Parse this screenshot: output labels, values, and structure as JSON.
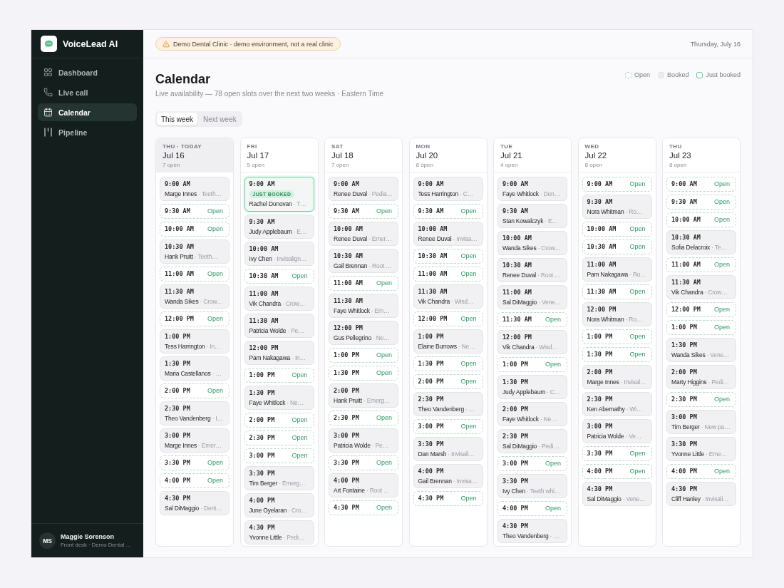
{
  "sidebar": {
    "app_name": "VoiceLead AI",
    "nav": [
      {
        "label": "Dashboard",
        "selected": false
      },
      {
        "label": "Live call",
        "selected": false
      },
      {
        "label": "Calendar",
        "selected": true
      },
      {
        "label": "Pipeline",
        "selected": false
      }
    ],
    "user": {
      "initials": "MS",
      "name": "Maggie Sorenson",
      "role": "Front desk · Demo Dental …"
    }
  },
  "top_bar": {
    "banner": "Demo Dental Clinic · demo environment, not a real clinic",
    "date": "Thursday, July 16"
  },
  "header": {
    "title": "Calendar",
    "subtitle": "Live availability — 78 open slots over the next two weeks · Eastern Time"
  },
  "legend": [
    {
      "kind": "open",
      "label": "Open"
    },
    {
      "kind": "booked",
      "label": "Booked"
    },
    {
      "kind": "just_booked",
      "label": "Just booked"
    }
  ],
  "tabs": [
    {
      "label": "This week",
      "selected": true
    },
    {
      "label": "Next week",
      "selected": false
    }
  ],
  "days": [
    {
      "day": "THU · TODAY",
      "date": "Jul 16",
      "open_count": "7 open",
      "today": true,
      "slots": [
        {
          "kind": "booked",
          "time": "9:00 AM",
          "patient": "Marge Innes",
          "detail": "· Teeth…"
        },
        {
          "kind": "open",
          "time": "9:30 AM",
          "label": "Open"
        },
        {
          "kind": "open",
          "time": "10:00 AM",
          "label": "Open"
        },
        {
          "kind": "booked",
          "time": "10:30 AM",
          "patient": "Hank Pruitt",
          "detail": "· Teeth…"
        },
        {
          "kind": "open",
          "time": "11:00 AM",
          "label": "Open"
        },
        {
          "kind": "booked",
          "time": "11:30 AM",
          "patient": "Wanda Sikes",
          "detail": "· Crow…"
        },
        {
          "kind": "open",
          "time": "12:00 PM",
          "label": "Open"
        },
        {
          "kind": "booked",
          "time": "1:00 PM",
          "patient": "Tess Harrington",
          "detail": "· In…"
        },
        {
          "kind": "booked",
          "time": "1:30 PM",
          "patient": "Maria Castellanos",
          "detail": "· …"
        },
        {
          "kind": "open",
          "time": "2:00 PM",
          "label": "Open"
        },
        {
          "kind": "booked",
          "time": "2:30 PM",
          "patient": "Theo Vandenberg",
          "detail": "· I…"
        },
        {
          "kind": "booked",
          "time": "3:00 PM",
          "patient": "Marge Innes",
          "detail": "· Emer…"
        },
        {
          "kind": "open",
          "time": "3:30 PM",
          "label": "Open"
        },
        {
          "kind": "open",
          "time": "4:00 PM",
          "label": "Open"
        },
        {
          "kind": "booked",
          "time": "4:30 PM",
          "patient": "Sal DiMaggio",
          "detail": "· Dent…"
        }
      ]
    },
    {
      "day": "FRI",
      "date": "Jul 17",
      "open_count": "5 open",
      "today": false,
      "slots": [
        {
          "kind": "just_booked",
          "time": "9:00 AM",
          "badge": "JUST BOOKED",
          "patient": "Rachel Donovan",
          "detail": "· T…"
        },
        {
          "kind": "booked",
          "time": "9:30 AM",
          "patient": "Judy Applebaum",
          "detail": "· E…"
        },
        {
          "kind": "booked",
          "time": "10:00 AM",
          "patient": "Ivy Chen",
          "detail": "· Invisalign…"
        },
        {
          "kind": "open",
          "time": "10:30 AM",
          "label": "Open"
        },
        {
          "kind": "booked",
          "time": "11:00 AM",
          "patient": "Vik Chandra",
          "detail": "· Crow…"
        },
        {
          "kind": "booked",
          "time": "11:30 AM",
          "patient": "Patricia Wolde",
          "detail": "· Pe…"
        },
        {
          "kind": "booked",
          "time": "12:00 PM",
          "patient": "Pam Nakagawa",
          "detail": "· In…"
        },
        {
          "kind": "open",
          "time": "1:00 PM",
          "label": "Open"
        },
        {
          "kind": "booked",
          "time": "1:30 PM",
          "patient": "Faye Whitlock",
          "detail": "· Ne…"
        },
        {
          "kind": "open",
          "time": "2:00 PM",
          "label": "Open"
        },
        {
          "kind": "open",
          "time": "2:30 PM",
          "label": "Open"
        },
        {
          "kind": "open",
          "time": "3:00 PM",
          "label": "Open"
        },
        {
          "kind": "booked",
          "time": "3:30 PM",
          "patient": "Tim Berger",
          "detail": "· Emerg…"
        },
        {
          "kind": "booked",
          "time": "4:00 PM",
          "patient": "June Oyelaran",
          "detail": "· Cro…"
        },
        {
          "kind": "booked",
          "time": "4:30 PM",
          "patient": "Yvonne Little",
          "detail": "· Pedi…"
        }
      ]
    },
    {
      "day": "SAT",
      "date": "Jul 18",
      "open_count": "7 open",
      "today": false,
      "slots": [
        {
          "kind": "booked",
          "time": "9:00 AM",
          "patient": "Renee Duval",
          "detail": "· Pedia…"
        },
        {
          "kind": "open",
          "time": "9:30 AM",
          "label": "Open"
        },
        {
          "kind": "booked",
          "time": "10:00 AM",
          "patient": "Renee Duval",
          "detail": "· Emer…"
        },
        {
          "kind": "booked",
          "time": "10:30 AM",
          "patient": "Gail Brennan",
          "detail": "· Root …"
        },
        {
          "kind": "open",
          "time": "11:00 AM",
          "label": "Open"
        },
        {
          "kind": "booked",
          "time": "11:30 AM",
          "patient": "Faye Whitlock",
          "detail": "· Em…"
        },
        {
          "kind": "booked",
          "time": "12:00 PM",
          "patient": "Gus Pellegrino",
          "detail": "· Ne…"
        },
        {
          "kind": "open",
          "time": "1:00 PM",
          "label": "Open"
        },
        {
          "kind": "open",
          "time": "1:30 PM",
          "label": "Open"
        },
        {
          "kind": "booked",
          "time": "2:00 PM",
          "patient": "Hank Pruitt",
          "detail": "· Emerg…"
        },
        {
          "kind": "open",
          "time": "2:30 PM",
          "label": "Open"
        },
        {
          "kind": "booked",
          "time": "3:00 PM",
          "patient": "Patricia Wolde",
          "detail": "· Pe…"
        },
        {
          "kind": "open",
          "time": "3:30 PM",
          "label": "Open"
        },
        {
          "kind": "booked",
          "time": "4:00 PM",
          "patient": "Art Fontaine",
          "detail": "· Root …"
        },
        {
          "kind": "open",
          "time": "4:30 PM",
          "label": "Open"
        }
      ]
    },
    {
      "day": "MON",
      "date": "Jul 20",
      "open_count": "8 open",
      "today": false,
      "slots": [
        {
          "kind": "booked",
          "time": "9:00 AM",
          "patient": "Tess Harrington",
          "detail": "· C…"
        },
        {
          "kind": "open",
          "time": "9:30 AM",
          "label": "Open"
        },
        {
          "kind": "booked",
          "time": "10:00 AM",
          "patient": "Renee Duval",
          "detail": "· Invisa…"
        },
        {
          "kind": "open",
          "time": "10:30 AM",
          "label": "Open"
        },
        {
          "kind": "open",
          "time": "11:00 AM",
          "label": "Open"
        },
        {
          "kind": "booked",
          "time": "11:30 AM",
          "patient": "Vik Chandra",
          "detail": "· Wisd…"
        },
        {
          "kind": "open",
          "time": "12:00 PM",
          "label": "Open"
        },
        {
          "kind": "booked",
          "time": "1:00 PM",
          "patient": "Elaine Burrows",
          "detail": "· Ne…"
        },
        {
          "kind": "open",
          "time": "1:30 PM",
          "label": "Open"
        },
        {
          "kind": "open",
          "time": "2:00 PM",
          "label": "Open"
        },
        {
          "kind": "booked",
          "time": "2:30 PM",
          "patient": "Theo Vandenberg",
          "detail": "· …"
        },
        {
          "kind": "open",
          "time": "3:00 PM",
          "label": "Open"
        },
        {
          "kind": "booked",
          "time": "3:30 PM",
          "patient": "Dan Marsh",
          "detail": "· Invisali…"
        },
        {
          "kind": "booked",
          "time": "4:00 PM",
          "patient": "Gail Brennan",
          "detail": "· Invisa…"
        },
        {
          "kind": "open",
          "time": "4:30 PM",
          "label": "Open"
        }
      ]
    },
    {
      "day": "TUE",
      "date": "Jul 21",
      "open_count": "4 open",
      "today": false,
      "slots": [
        {
          "kind": "booked",
          "time": "9:00 AM",
          "patient": "Faye Whitlock",
          "detail": "· Den…"
        },
        {
          "kind": "booked",
          "time": "9:30 AM",
          "patient": "Stan Kowalczyk",
          "detail": "· E…"
        },
        {
          "kind": "booked",
          "time": "10:00 AM",
          "patient": "Wanda Sikes",
          "detail": "· Crow…"
        },
        {
          "kind": "booked",
          "time": "10:30 AM",
          "patient": "Renee Duval",
          "detail": "· Root …"
        },
        {
          "kind": "booked",
          "time": "11:00 AM",
          "patient": "Sal DiMaggio",
          "detail": "· Vene…"
        },
        {
          "kind": "open",
          "time": "11:30 AM",
          "label": "Open"
        },
        {
          "kind": "booked",
          "time": "12:00 PM",
          "patient": "Vik Chandra",
          "detail": "· Wisd…"
        },
        {
          "kind": "open",
          "time": "1:00 PM",
          "label": "Open"
        },
        {
          "kind": "booked",
          "time": "1:30 PM",
          "patient": "Judy Applebaum",
          "detail": "· C…"
        },
        {
          "kind": "booked",
          "time": "2:00 PM",
          "patient": "Faye Whitlock",
          "detail": "· Ne…"
        },
        {
          "kind": "booked",
          "time": "2:30 PM",
          "patient": "Sal DiMaggio",
          "detail": "· Pedi…"
        },
        {
          "kind": "open",
          "time": "3:00 PM",
          "label": "Open"
        },
        {
          "kind": "booked",
          "time": "3:30 PM",
          "patient": "Ivy Chen",
          "detail": "· Teeth whi…"
        },
        {
          "kind": "open",
          "time": "4:00 PM",
          "label": "Open"
        },
        {
          "kind": "booked",
          "time": "4:30 PM",
          "patient": "Theo Vandenberg",
          "detail": "· …"
        }
      ]
    },
    {
      "day": "WED",
      "date": "Jul 22",
      "open_count": "8 open",
      "today": false,
      "slots": [
        {
          "kind": "open",
          "time": "9:00 AM",
          "label": "Open"
        },
        {
          "kind": "booked",
          "time": "9:30 AM",
          "patient": "Nora Whitman",
          "detail": "· Ro…"
        },
        {
          "kind": "open",
          "time": "10:00 AM",
          "label": "Open"
        },
        {
          "kind": "open",
          "time": "10:30 AM",
          "label": "Open"
        },
        {
          "kind": "booked",
          "time": "11:00 AM",
          "patient": "Pam Nakagawa",
          "detail": "· Ro…"
        },
        {
          "kind": "open",
          "time": "11:30 AM",
          "label": "Open"
        },
        {
          "kind": "booked",
          "time": "12:00 PM",
          "patient": "Nora Whitman",
          "detail": "· Ro…"
        },
        {
          "kind": "open",
          "time": "1:00 PM",
          "label": "Open"
        },
        {
          "kind": "open",
          "time": "1:30 PM",
          "label": "Open"
        },
        {
          "kind": "booked",
          "time": "2:00 PM",
          "patient": "Marge Innes",
          "detail": "· Invisal…"
        },
        {
          "kind": "booked",
          "time": "2:30 PM",
          "patient": "Ken Abernathy",
          "detail": "· Wi…"
        },
        {
          "kind": "booked",
          "time": "3:00 PM",
          "patient": "Patricia Wolde",
          "detail": "· Ve…"
        },
        {
          "kind": "open",
          "time": "3:30 PM",
          "label": "Open"
        },
        {
          "kind": "open",
          "time": "4:00 PM",
          "label": "Open"
        },
        {
          "kind": "booked",
          "time": "4:30 PM",
          "patient": "Sal DiMaggio",
          "detail": "· Vene…"
        }
      ]
    },
    {
      "day": "THU",
      "date": "Jul 23",
      "open_count": "8 open",
      "today": false,
      "slots": [
        {
          "kind": "open",
          "time": "9:00 AM",
          "label": "Open"
        },
        {
          "kind": "open",
          "time": "9:30 AM",
          "label": "Open"
        },
        {
          "kind": "open",
          "time": "10:00 AM",
          "label": "Open"
        },
        {
          "kind": "booked",
          "time": "10:30 AM",
          "patient": "Sofia Delacroix",
          "detail": "· Te…"
        },
        {
          "kind": "open",
          "time": "11:00 AM",
          "label": "Open"
        },
        {
          "kind": "booked",
          "time": "11:30 AM",
          "patient": "Vik Chandra",
          "detail": "· Crow…"
        },
        {
          "kind": "open",
          "time": "12:00 PM",
          "label": "Open"
        },
        {
          "kind": "open",
          "time": "1:00 PM",
          "label": "Open"
        },
        {
          "kind": "booked",
          "time": "1:30 PM",
          "patient": "Wanda Sikes",
          "detail": "· Vene…"
        },
        {
          "kind": "booked",
          "time": "2:00 PM",
          "patient": "Marty Higgins",
          "detail": "· Pedi…"
        },
        {
          "kind": "open",
          "time": "2:30 PM",
          "label": "Open"
        },
        {
          "kind": "booked",
          "time": "3:00 PM",
          "patient": "Tim Berger",
          "detail": "· New pa…"
        },
        {
          "kind": "booked",
          "time": "3:30 PM",
          "patient": "Yvonne Little",
          "detail": "· Eme…"
        },
        {
          "kind": "open",
          "time": "4:00 PM",
          "label": "Open"
        },
        {
          "kind": "booked",
          "time": "4:30 PM",
          "patient": "Cliff Hanley",
          "detail": "· Invisali…"
        }
      ]
    }
  ]
}
